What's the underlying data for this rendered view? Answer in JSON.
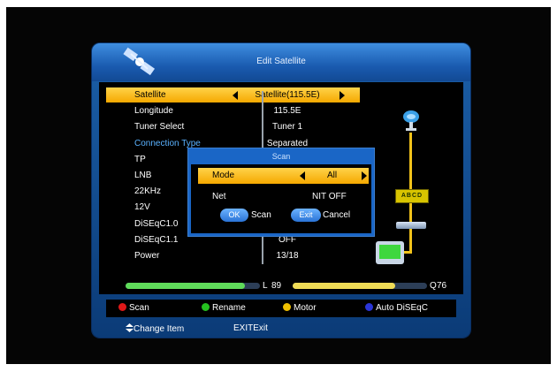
{
  "window": {
    "title": "Edit Satellite"
  },
  "settings": {
    "rows": [
      {
        "label": "Satellite",
        "value": "Satellite(115.5E)"
      },
      {
        "label": "Longitude",
        "value": "115.5E"
      },
      {
        "label": "Tuner Select",
        "value": "Tuner 1"
      },
      {
        "label": "Connection Type",
        "value": "Separated"
      },
      {
        "label": "TP",
        "value": ""
      },
      {
        "label": "LNB",
        "value": ""
      },
      {
        "label": "22KHz",
        "value": ""
      },
      {
        "label": "12V",
        "value": ""
      },
      {
        "label": "DiSEqC1.0",
        "value": ""
      },
      {
        "label": "DiSEqC1.1",
        "value": "OFF"
      },
      {
        "label": "Power",
        "value": "13/18"
      }
    ]
  },
  "diagram": {
    "switch_label": "ABCD"
  },
  "signal": {
    "level_label": "L",
    "level_value": "89",
    "level_fraction": 0.89,
    "quality_label": "Q",
    "quality_value": "76",
    "quality_fraction": 0.76
  },
  "color_keys": [
    {
      "label": "Scan",
      "color": "#e01818"
    },
    {
      "label": "Rename",
      "color": "#25c01f"
    },
    {
      "label": "Motor",
      "color": "#f0c000"
    },
    {
      "label": "Auto DiSEqC",
      "color": "#2a35d8"
    }
  ],
  "footer": {
    "change_item": "Change Item",
    "exit_key": "EXIT",
    "exit_label": "Exit"
  },
  "dialog": {
    "title": "Scan",
    "mode_label": "Mode",
    "mode_value": "All",
    "net_label": "Net",
    "net_value": "NIT OFF",
    "ok_key": "OK",
    "ok_label": "Scan",
    "exit_key": "Exit",
    "exit_label": "Cancel"
  },
  "colors": {
    "highlight": "#f5b400",
    "panel": "#1a5bb0",
    "accent_text": "#5ab2ff"
  }
}
